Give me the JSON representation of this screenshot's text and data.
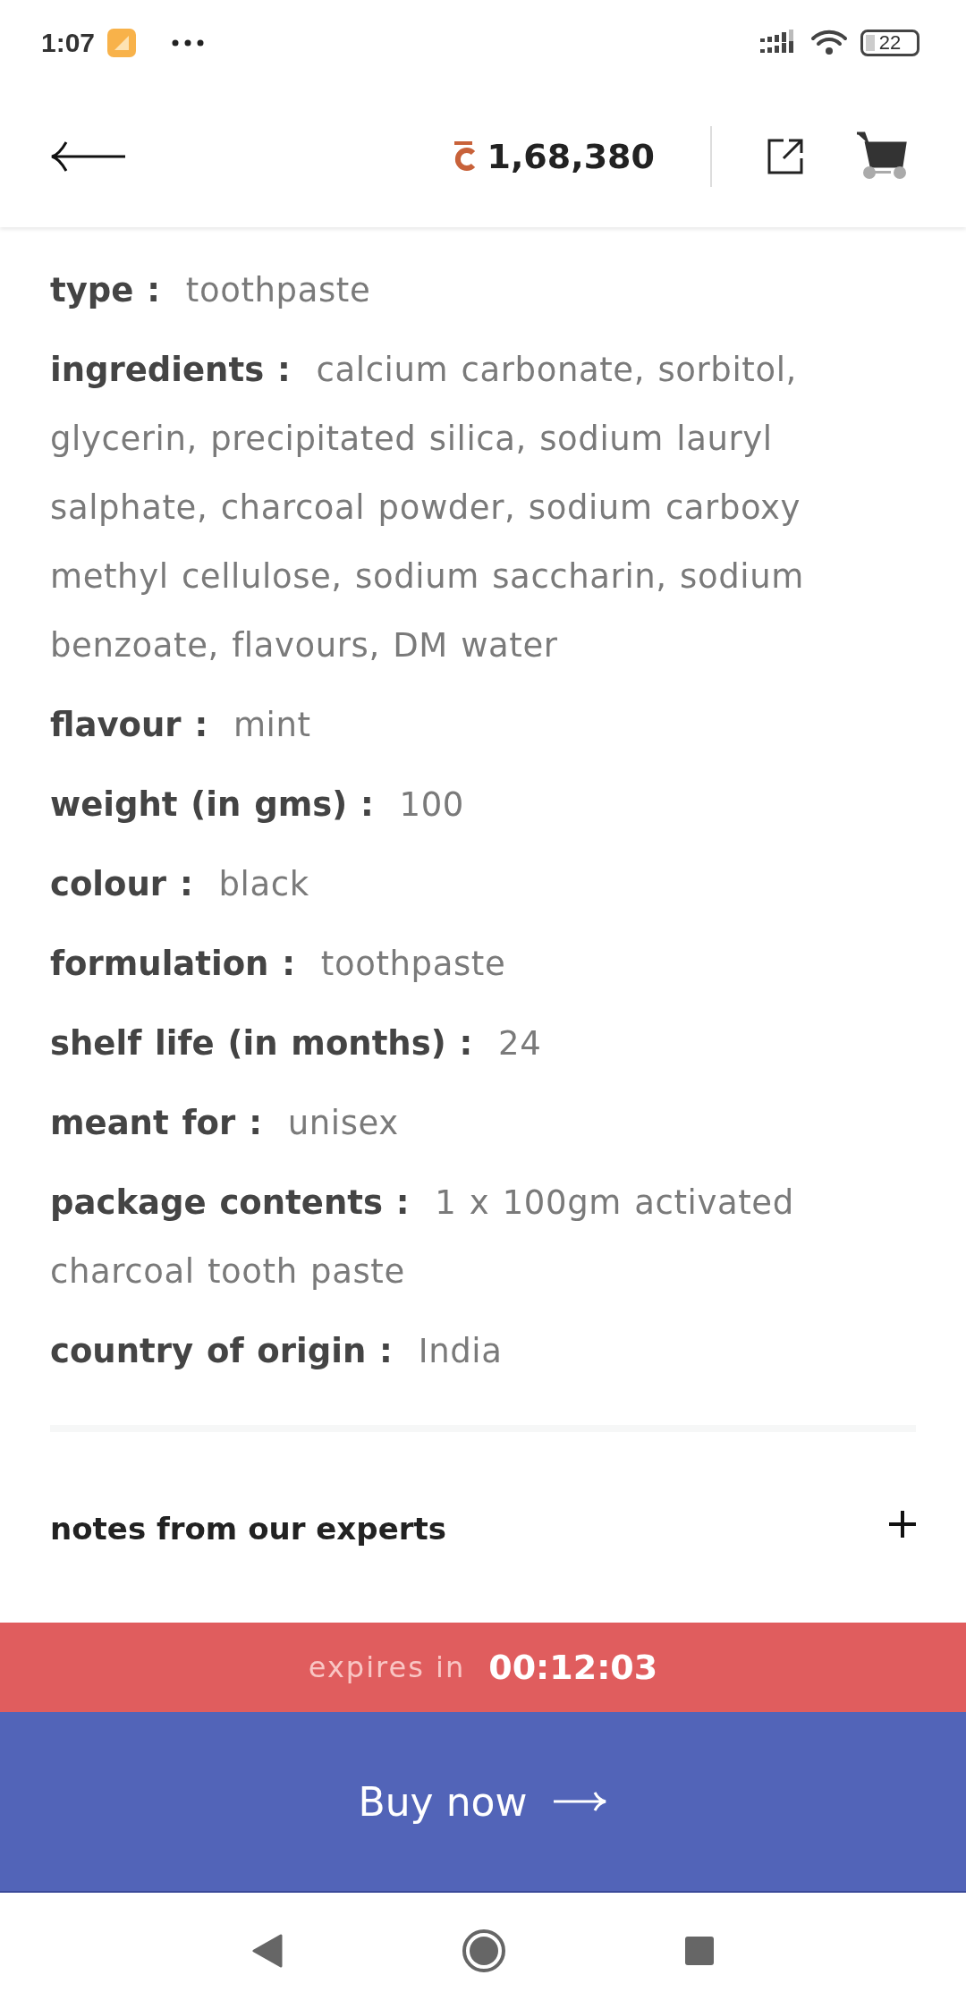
{
  "status_bar": {
    "time": "1:07",
    "battery": "22"
  },
  "header": {
    "balance": "1,68,380"
  },
  "specs": [
    {
      "label": "type :",
      "value": "toothpaste"
    },
    {
      "label": "ingredients :",
      "value": "calcium carbonate, sorbitol, glycerin, precipitated silica, sodium lauryl salphate, charcoal powder, sodium carboxy methyl cellulose, sodium saccharin, sodium benzoate, flavours, DM water"
    },
    {
      "label": "flavour :",
      "value": "mint"
    },
    {
      "label": "weight (in gms) :",
      "value": "100"
    },
    {
      "label": "colour :",
      "value": "black"
    },
    {
      "label": "formulation :",
      "value": "toothpaste"
    },
    {
      "label": "shelf life (in months) :",
      "value": "24"
    },
    {
      "label": "meant for :",
      "value": "unisex"
    },
    {
      "label": "package contents :",
      "value": "1 x 100gm activated charcoal tooth paste"
    },
    {
      "label": "country of origin :",
      "value": "India"
    }
  ],
  "section": {
    "title": "notes from our experts"
  },
  "timer": {
    "label": "expires in",
    "value": "00:12:03"
  },
  "buy_button": {
    "label": "Buy now"
  }
}
